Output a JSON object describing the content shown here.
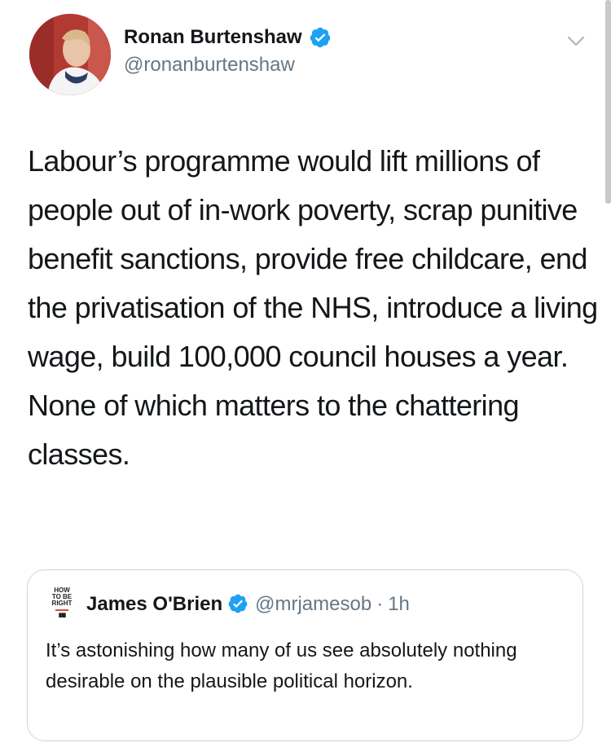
{
  "tweet": {
    "author": {
      "display_name": "Ronan Burtenshaw",
      "handle": "@ronanburtenshaw",
      "verified": true,
      "avatar_icon": "user-photo-avatar"
    },
    "text": "Labour’s programme would lift millions of people out of in-work poverty, scrap punitive benefit sanctions, provide free childcare, end the privatisation of the NHS, introduce a living wage, build 100,000 council houses a year. None of which matters to the chattering classes.",
    "menu_icon": "chevron-down-icon"
  },
  "quoted_tweet": {
    "author": {
      "display_name": "James O'Brien",
      "handle": "@mrjamesob",
      "verified": true,
      "avatar_text": [
        "HOW",
        "TO BE",
        "RIGHT"
      ]
    },
    "separator": "·",
    "time": "1h",
    "text": "It’s astonishing how many of us see absolutely nothing desirable on the plausible political horizon."
  },
  "colors": {
    "text_primary": "#14171a",
    "text_secondary": "#657786",
    "verified_blue": "#1da1f2",
    "border": "#ccd6dd"
  }
}
